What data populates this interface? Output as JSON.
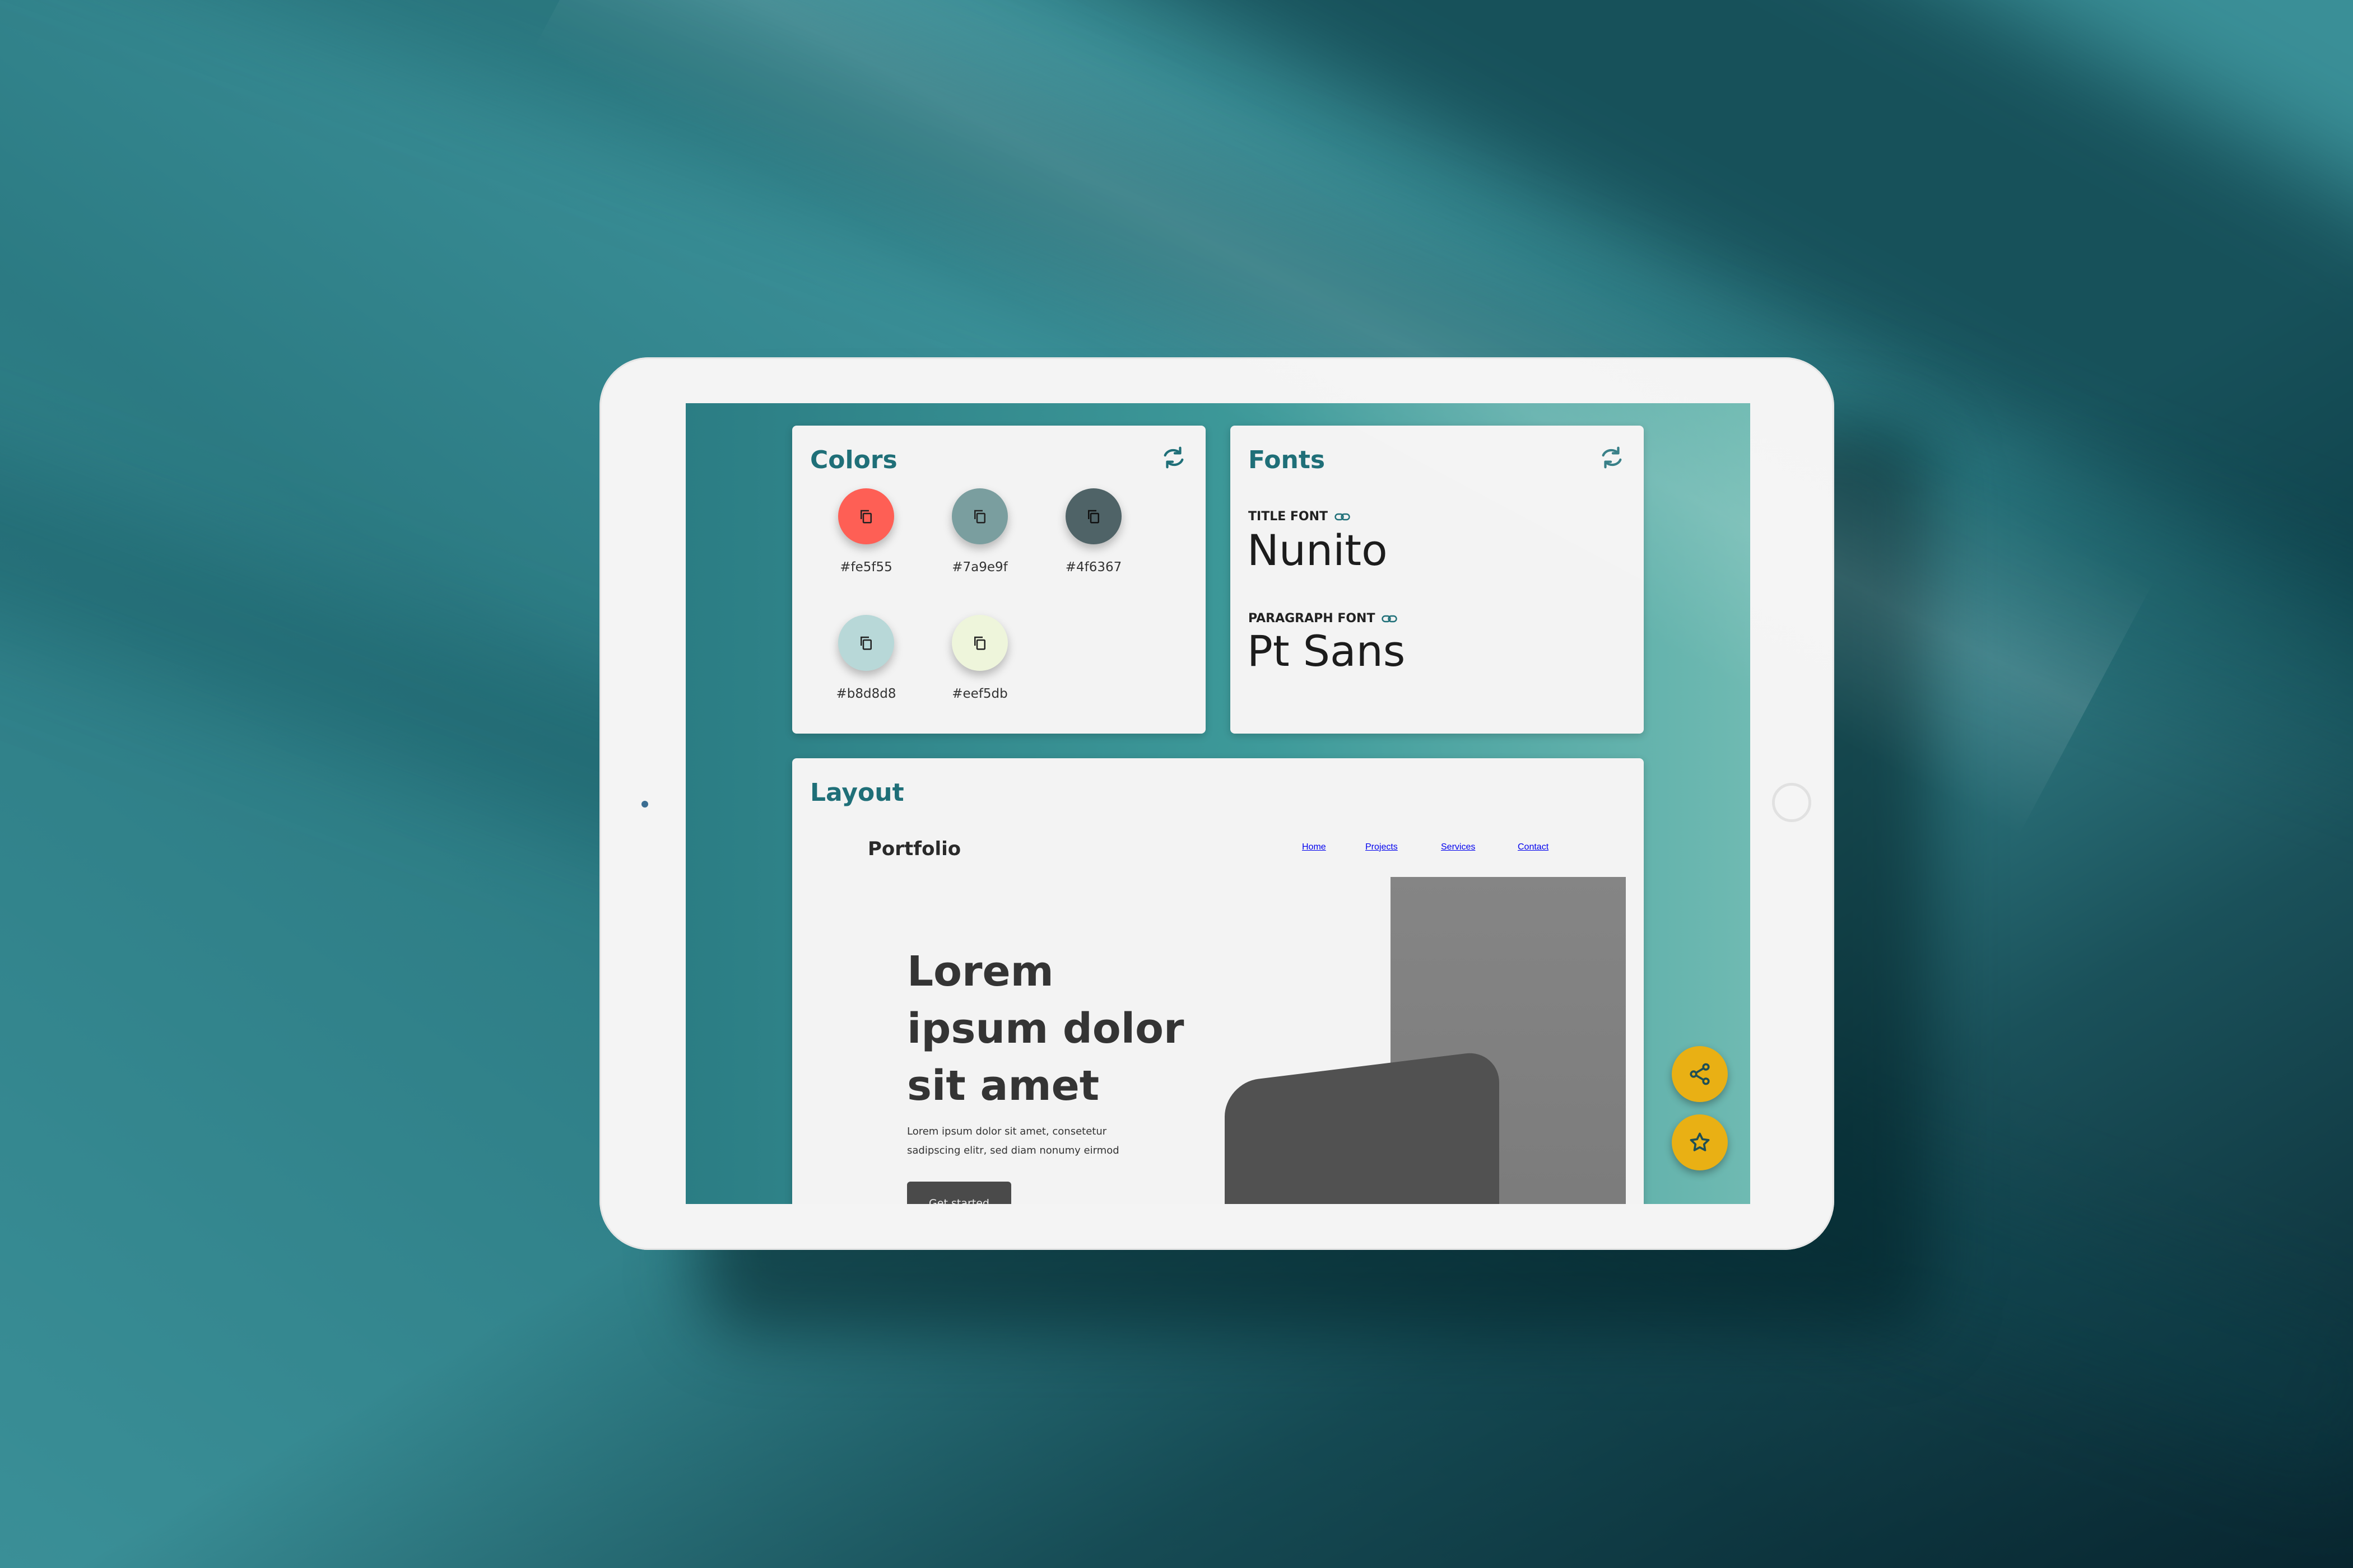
{
  "colors_card": {
    "title": "Colors",
    "refresh_icon": "refresh-icon",
    "swatches": [
      {
        "hex": "#fe5f55",
        "label": "#fe5f55",
        "icon": "copy-icon"
      },
      {
        "hex": "#7a9e9f",
        "label": "#7a9e9f",
        "icon": "copy-icon"
      },
      {
        "hex": "#4f6367",
        "label": "#4f6367",
        "icon": "copy-icon"
      },
      {
        "hex": "#b8d8d8",
        "label": "#b8d8d8",
        "icon": "copy-icon"
      },
      {
        "hex": "#eef5db",
        "label": "#eef5db",
        "icon": "copy-icon"
      }
    ]
  },
  "fonts_card": {
    "title": "Fonts",
    "refresh_icon": "refresh-icon",
    "title_font_label": "TITLE FONT",
    "title_font_name": "Nunito",
    "paragraph_font_label": "PARAGRAPH FONT",
    "paragraph_font_name": "Pt Sans",
    "link_icon": "link-icon"
  },
  "layout_card": {
    "title": "Layout",
    "brand": "Portfolio",
    "nav": [
      "Home",
      "Projects",
      "Services",
      "Contact"
    ],
    "hero_title": "Lorem ipsum dolor sit amet",
    "hero_text": "Lorem ipsum dolor sit amet, consetetur sadipscing elitr, sed diam nonumy eirmod",
    "hero_button": "Get started"
  },
  "fabs": {
    "share_icon": "share-icon",
    "star_icon": "star-icon"
  },
  "theme": {
    "accent": "#1f6f78",
    "fab_color": "#e9b014",
    "background": "#3a8f97"
  }
}
